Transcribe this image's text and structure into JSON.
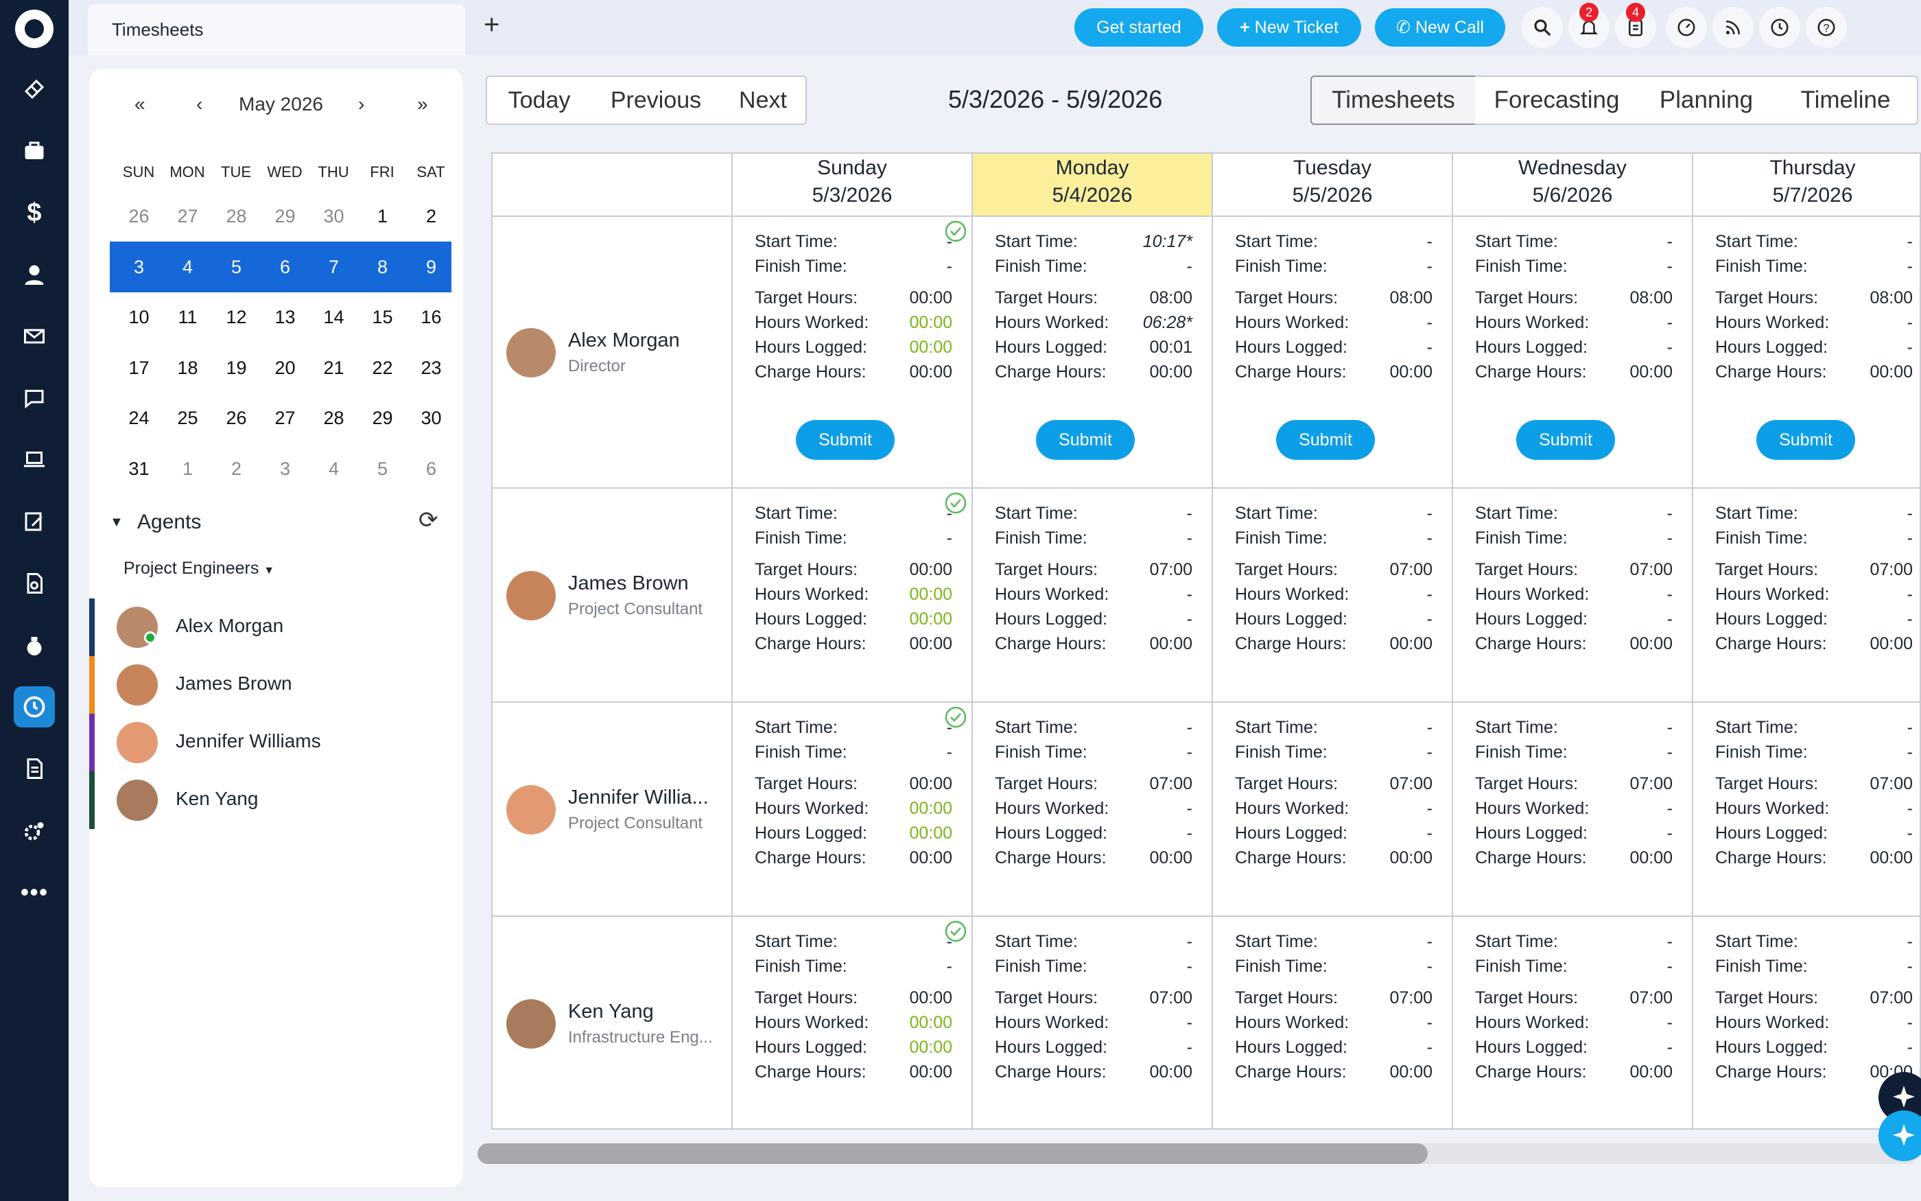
{
  "topbar": {
    "tab_title": "Timesheets",
    "new_tab": "+",
    "get_started": "Get started",
    "new_ticket": "New Ticket",
    "new_call": "New Call",
    "notification_badge": "2",
    "tasks_badge": "4"
  },
  "calendar": {
    "first": "«",
    "prev": "‹",
    "next": "›",
    "last": "»",
    "month": "May 2026",
    "weekdays": [
      "SUN",
      "MON",
      "TUE",
      "WED",
      "THU",
      "FRI",
      "SAT"
    ],
    "weeks": [
      [
        "26",
        "27",
        "28",
        "29",
        "30",
        "1",
        "2"
      ],
      [
        "3",
        "4",
        "5",
        "6",
        "7",
        "8",
        "9"
      ],
      [
        "10",
        "11",
        "12",
        "13",
        "14",
        "15",
        "16"
      ],
      [
        "17",
        "18",
        "19",
        "20",
        "21",
        "22",
        "23"
      ],
      [
        "24",
        "25",
        "26",
        "27",
        "28",
        "29",
        "30"
      ],
      [
        "31",
        "1",
        "2",
        "3",
        "4",
        "5",
        "6"
      ]
    ],
    "selected_week": 1
  },
  "agents": {
    "title": "Agents",
    "group": "Project Engineers",
    "list": [
      {
        "name": "Alex Morgan",
        "color": "#1b3a6b"
      },
      {
        "name": "James Brown",
        "color": "#f08a1c"
      },
      {
        "name": "Jennifer Williams",
        "color": "#6a2fb4"
      },
      {
        "name": "Ken Yang",
        "color": "#1d4d3b"
      }
    ]
  },
  "nav": {
    "today": "Today",
    "previous": "Previous",
    "next": "Next",
    "range": "5/3/2026 - 5/9/2026"
  },
  "views": [
    "Timesheets",
    "Forecasting",
    "Planning",
    "Timeline"
  ],
  "active_view": "Timesheets",
  "days": [
    {
      "name": "Sunday",
      "date": "5/3/2026"
    },
    {
      "name": "Monday",
      "date": "5/4/2026"
    },
    {
      "name": "Tuesday",
      "date": "5/5/2026"
    },
    {
      "name": "Wednesday",
      "date": "5/6/2026"
    },
    {
      "name": "Thursday",
      "date": "5/7/2026"
    }
  ],
  "labels": {
    "start": "Start Time:",
    "finish": "Finish Time:",
    "target": "Target Hours:",
    "worked": "Hours Worked:",
    "logged": "Hours Logged:",
    "charge": "Charge Hours:",
    "submit": "Submit"
  },
  "rows": [
    {
      "name": "Alex Morgan",
      "role": "Director",
      "cells": [
        {
          "start": "-",
          "finish": "-",
          "target": "00:00",
          "worked": "00:00",
          "logged": "00:00",
          "charge": "00:00",
          "check": true,
          "submit": true
        },
        {
          "start": "10:17*",
          "finish": "-",
          "target": "08:00",
          "worked": "06:28*",
          "logged": "00:01",
          "charge": "00:00",
          "check": false,
          "submit": true
        },
        {
          "start": "-",
          "finish": "-",
          "target": "08:00",
          "worked": "-",
          "logged": "-",
          "charge": "00:00",
          "check": false,
          "submit": true
        },
        {
          "start": "-",
          "finish": "-",
          "target": "08:00",
          "worked": "-",
          "logged": "-",
          "charge": "00:00",
          "check": false,
          "submit": true
        },
        {
          "start": "-",
          "finish": "-",
          "target": "08:00",
          "worked": "-",
          "logged": "-",
          "charge": "00:00",
          "check": false,
          "submit": true
        }
      ]
    },
    {
      "name": "James Brown",
      "role": "Project Consultant",
      "cells": [
        {
          "start": "-",
          "finish": "-",
          "target": "00:00",
          "worked": "00:00",
          "logged": "00:00",
          "charge": "00:00",
          "check": true,
          "submit": false
        },
        {
          "start": "-",
          "finish": "-",
          "target": "07:00",
          "worked": "-",
          "logged": "-",
          "charge": "00:00",
          "check": false,
          "submit": false
        },
        {
          "start": "-",
          "finish": "-",
          "target": "07:00",
          "worked": "-",
          "logged": "-",
          "charge": "00:00",
          "check": false,
          "submit": false
        },
        {
          "start": "-",
          "finish": "-",
          "target": "07:00",
          "worked": "-",
          "logged": "-",
          "charge": "00:00",
          "check": false,
          "submit": false
        },
        {
          "start": "-",
          "finish": "-",
          "target": "07:00",
          "worked": "-",
          "logged": "-",
          "charge": "00:00",
          "check": false,
          "submit": false
        }
      ]
    },
    {
      "name": "Jennifer Willia...",
      "role": "Project Consultant",
      "cells": [
        {
          "start": "-",
          "finish": "-",
          "target": "00:00",
          "worked": "00:00",
          "logged": "00:00",
          "charge": "00:00",
          "check": true,
          "submit": false
        },
        {
          "start": "-",
          "finish": "-",
          "target": "07:00",
          "worked": "-",
          "logged": "-",
          "charge": "00:00",
          "check": false,
          "submit": false
        },
        {
          "start": "-",
          "finish": "-",
          "target": "07:00",
          "worked": "-",
          "logged": "-",
          "charge": "00:00",
          "check": false,
          "submit": false
        },
        {
          "start": "-",
          "finish": "-",
          "target": "07:00",
          "worked": "-",
          "logged": "-",
          "charge": "00:00",
          "check": false,
          "submit": false
        },
        {
          "start": "-",
          "finish": "-",
          "target": "07:00",
          "worked": "-",
          "logged": "-",
          "charge": "00:00",
          "check": false,
          "submit": false
        }
      ]
    },
    {
      "name": "Ken Yang",
      "role": "Infrastructure Eng...",
      "cells": [
        {
          "start": "-",
          "finish": "-",
          "target": "00:00",
          "worked": "00:00",
          "logged": "00:00",
          "charge": "00:00",
          "check": true,
          "submit": false
        },
        {
          "start": "-",
          "finish": "-",
          "target": "07:00",
          "worked": "-",
          "logged": "-",
          "charge": "00:00",
          "check": false,
          "submit": false
        },
        {
          "start": "-",
          "finish": "-",
          "target": "07:00",
          "worked": "-",
          "logged": "-",
          "charge": "00:00",
          "check": false,
          "submit": false
        },
        {
          "start": "-",
          "finish": "-",
          "target": "07:00",
          "worked": "-",
          "logged": "-",
          "charge": "00:00",
          "check": false,
          "submit": false
        },
        {
          "start": "-",
          "finish": "-",
          "target": "07:00",
          "worked": "-",
          "logged": "-",
          "charge": "00:00",
          "check": false,
          "submit": false
        }
      ]
    }
  ],
  "colors": {
    "accent": "#14a8ee",
    "selected_week": "#1668d8",
    "today_highlight": "#fcef9c",
    "worked_green": "#7cb518",
    "sidebar_bg": "#0f1e35"
  },
  "icons": {
    "sidebar": [
      "logo-icon",
      "ticket-icon",
      "briefcase-icon",
      "dollar-icon",
      "user-icon",
      "mail-icon",
      "chat-icon",
      "laptop-icon",
      "edit-icon",
      "document-search-icon",
      "money-bag-icon",
      "clock-icon",
      "file-icon",
      "gear-icon",
      "more-icon"
    ],
    "topbar": [
      "search-icon",
      "bell-icon",
      "clipboard-icon",
      "dashboard-icon",
      "rss-icon",
      "history-icon",
      "help-icon"
    ]
  }
}
